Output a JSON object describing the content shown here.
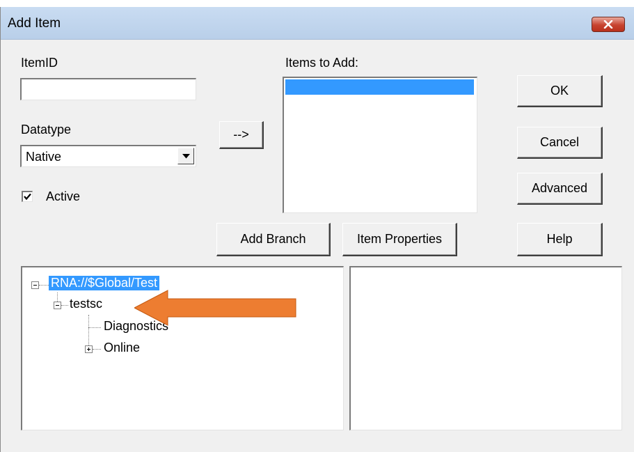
{
  "window": {
    "title": "Add Item",
    "close_icon": "close-icon"
  },
  "form": {
    "itemid_label": "ItemID",
    "itemid_value": "",
    "datatype_label": "Datatype",
    "datatype_value": "Native",
    "active_label": "Active",
    "active_checked": true,
    "items_to_add_label": "Items to Add:",
    "items_to_add": [
      ""
    ],
    "move_button": "-->"
  },
  "buttons": {
    "ok": "OK",
    "cancel": "Cancel",
    "advanced": "Advanced",
    "help": "Help",
    "add_branch": "Add Branch",
    "item_properties": "Item Properties"
  },
  "tree": {
    "root": "RNA://$Global/Test",
    "child": "testsc",
    "grandchildren": [
      "Diagnostics",
      "Online"
    ]
  },
  "annotation": {
    "arrow_color": "#ed7d31",
    "arrow_icon": "left-arrow-icon"
  }
}
